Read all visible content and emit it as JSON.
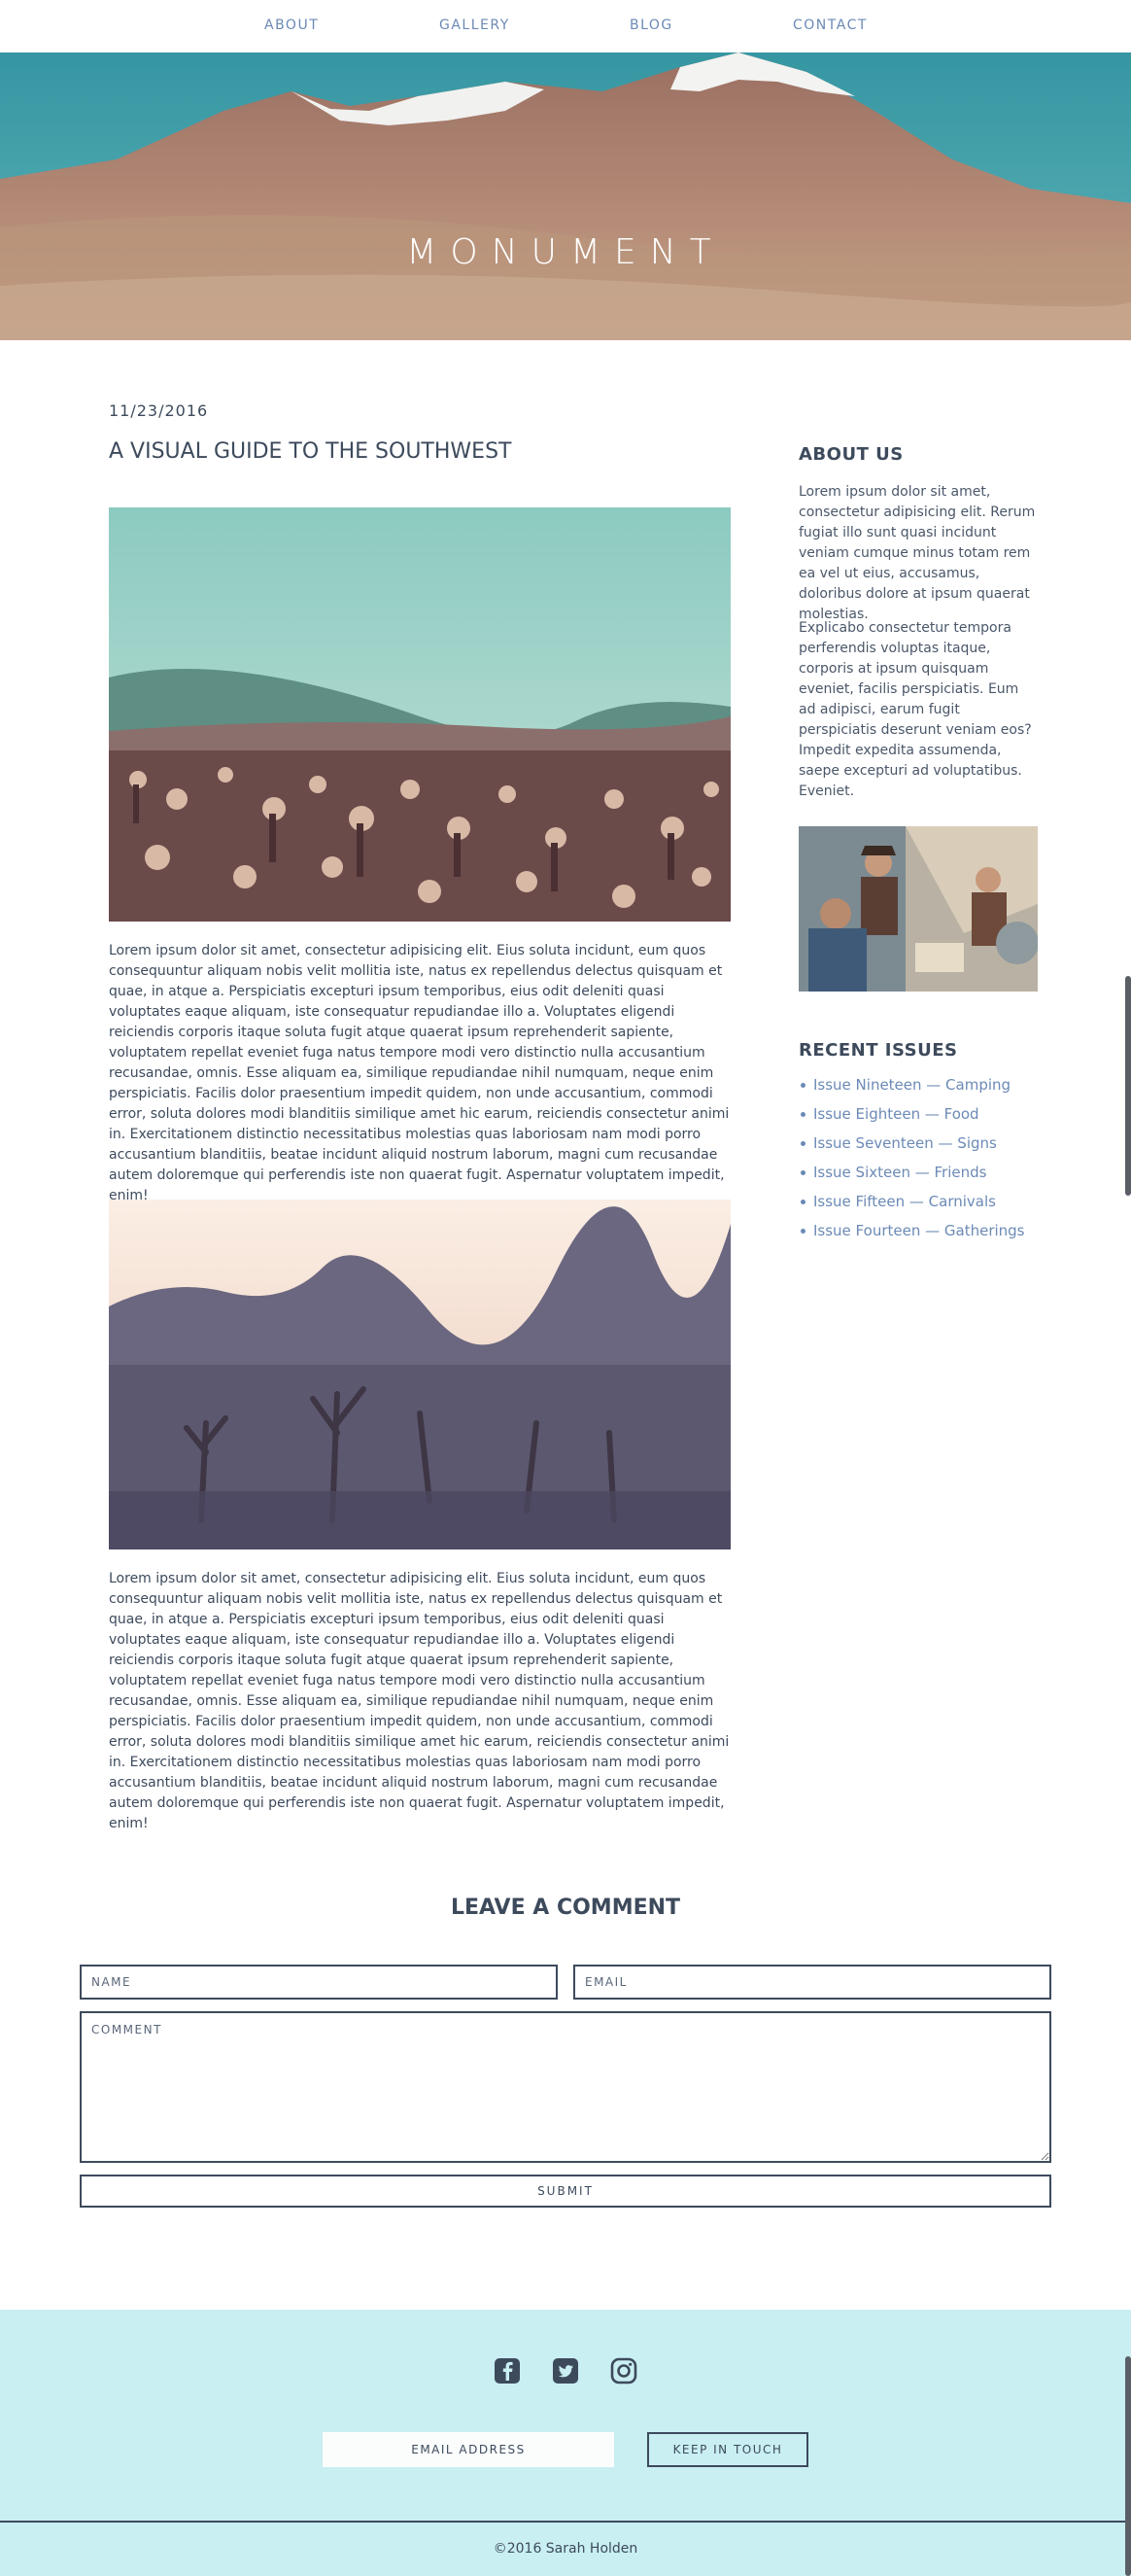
{
  "nav": {
    "items": [
      {
        "label": "ABOUT"
      },
      {
        "label": "GALLERY"
      },
      {
        "label": "BLOG"
      },
      {
        "label": "CONTACT"
      }
    ]
  },
  "hero": {
    "title": "MONUMENT"
  },
  "post": {
    "date": "11/23/2016",
    "title": "A VISUAL GUIDE TO THE SOUTHWEST",
    "paragraph_1": "Lorem ipsum dolor sit amet, consectetur adipisicing elit. Eius soluta incidunt, eum quos consequuntur aliquam nobis velit mollitia iste, natus ex repellendus delectus quisquam et quae, in atque a. Perspiciatis excepturi ipsum temporibus, eius odit deleniti quasi voluptates eaque aliquam, iste consequatur repudiandae illo a. Voluptates eligendi reiciendis corporis itaque soluta fugit atque quaerat ipsum reprehenderit sapiente, voluptatem repellat eveniet fuga natus tempore modi vero distinctio nulla accusantium recusandae, omnis. Esse aliquam ea, similique repudiandae nihil numquam, neque enim perspiciatis. Facilis dolor praesentium impedit quidem, non unde accusantium, commodi error, soluta dolores modi blanditiis similique amet hic earum, reiciendis consectetur animi in. Exercitationem distinctio necessitatibus molestias quas laboriosam nam modi porro accusantium blanditiis, beatae incidunt aliquid nostrum laborum, magni cum recusandae autem doloremque qui perferendis iste non quaerat fugit. Aspernatur voluptatem impedit, enim!",
    "paragraph_2": "Lorem ipsum dolor sit amet, consectetur adipisicing elit. Eius soluta incidunt, eum quos consequuntur aliquam nobis velit mollitia iste, natus ex repellendus delectus quisquam et quae, in atque a. Perspiciatis excepturi ipsum temporibus, eius odit deleniti quasi voluptates eaque aliquam, iste consequatur repudiandae illo a. Voluptates eligendi reiciendis corporis itaque soluta fugit atque quaerat ipsum reprehenderit sapiente, voluptatem repellat eveniet fuga natus tempore modi vero distinctio nulla accusantium recusandae, omnis. Esse aliquam ea, similique repudiandae nihil numquam, neque enim perspiciatis. Facilis dolor praesentium impedit quidem, non unde accusantium, commodi error, soluta dolores modi blanditiis similique amet hic earum, reiciendis consectetur animi in. Exercitationem distinctio necessitatibus molestias quas laboriosam nam modi porro accusantium blanditiis, beatae incidunt aliquid nostrum laborum, magni cum recusandae autem doloremque qui perferendis iste non quaerat fugit. Aspernatur voluptatem impedit, enim!"
  },
  "sidebar": {
    "about_heading": "ABOUT US",
    "about_p1": "Lorem ipsum dolor sit amet, consectetur adipisicing elit. Rerum fugiat illo sunt quasi incidunt veniam cumque minus totam rem ea vel ut eius, accusamus, doloribus dolore at ipsum quaerat molestias.",
    "about_p2": "Explicabo consectetur tempora perferendis voluptas itaque, corporis at ipsum quisquam eveniet, facilis perspiciatis. Eum ad adipisci, earum fugit perspiciatis deserunt veniam eos? Impedit expedita assumenda, saepe excepturi ad voluptatibus. Eveniet.",
    "issues_heading": "RECENT ISSUES",
    "issues": [
      {
        "label": "Issue Nineteen — Camping"
      },
      {
        "label": "Issue Eighteen — Food"
      },
      {
        "label": "Issue Seventeen — Signs"
      },
      {
        "label": "Issue Sixteen — Friends"
      },
      {
        "label": "Issue Fifteen — Carnivals"
      },
      {
        "label": "Issue Fourteen — Gatherings"
      }
    ]
  },
  "comment_form": {
    "heading": "LEAVE A COMMENT",
    "name_placeholder": "NAME",
    "email_placeholder": "EMAIL",
    "comment_placeholder": "COMMENT",
    "submit_label": "SUBMIT"
  },
  "footer": {
    "social_icons": [
      "facebook-icon",
      "twitter-icon",
      "instagram-icon"
    ],
    "email_placeholder": "EMAIL ADDRESS",
    "keep_label": "KEEP IN TOUCH",
    "copyright": "©2016 Sarah Holden"
  },
  "colors": {
    "text": "#3d4a5c",
    "link": "#6b8ab5",
    "footer_bg": "#c9eff2"
  }
}
